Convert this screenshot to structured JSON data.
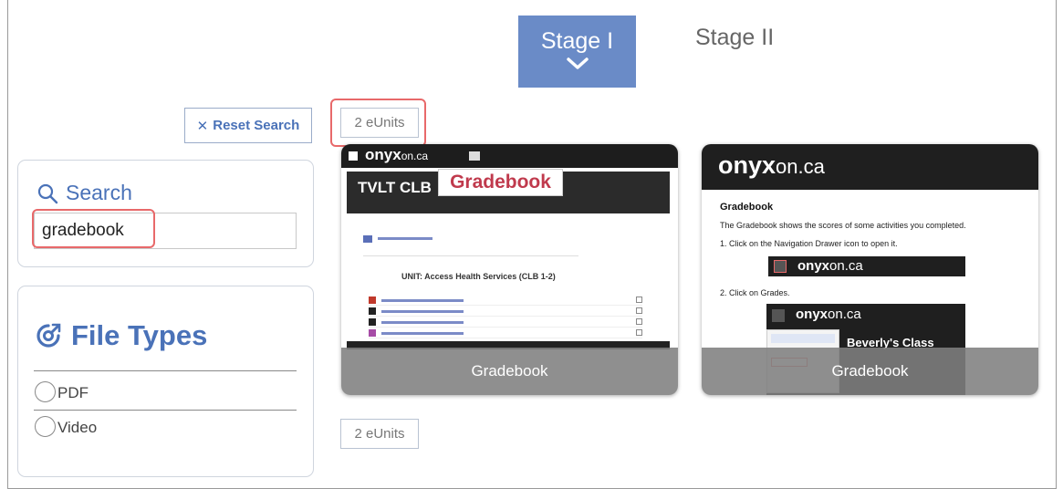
{
  "tabs": [
    {
      "label": "Stage I",
      "active": true
    },
    {
      "label": "Stage II",
      "active": false
    }
  ],
  "reset_search": {
    "icon": "x-icon",
    "label": "Reset Search"
  },
  "results": {
    "count_label_top": "2 eUnits",
    "count_label_bottom": "2 eUnits"
  },
  "search": {
    "title": "Search",
    "icon": "search-icon",
    "value": "gradebook"
  },
  "file_types": {
    "title": "File Types",
    "icon": "file-types-icon",
    "options": [
      {
        "label": "PDF",
        "checked": false
      },
      {
        "label": "Video",
        "checked": false
      }
    ]
  },
  "cards": [
    {
      "caption": "Gradebook",
      "thumb": {
        "logo_main": "onyx",
        "logo_tld": "on.ca",
        "banner": "TVLT CLB",
        "overlay_label": "Gradebook",
        "unit_heading": "UNIT: Access Health Services (CLB 1-2)"
      }
    },
    {
      "caption": "Gradebook",
      "thumb": {
        "logo_main": "onyx",
        "logo_tld": "on.ca",
        "heading": "Gradebook",
        "line1": "The Gradebook shows the scores of some activities you completed.",
        "line2": "1. Click on the Navigation Drawer icon to open it.",
        "line3": "2. Click on Grades.",
        "class_title": "Beverly's Class"
      }
    }
  ],
  "colors": {
    "accent": "#6a8bc7",
    "link": "#4a72b8",
    "highlight": "#e8696a",
    "gradebook_red": "#c03a4d"
  }
}
